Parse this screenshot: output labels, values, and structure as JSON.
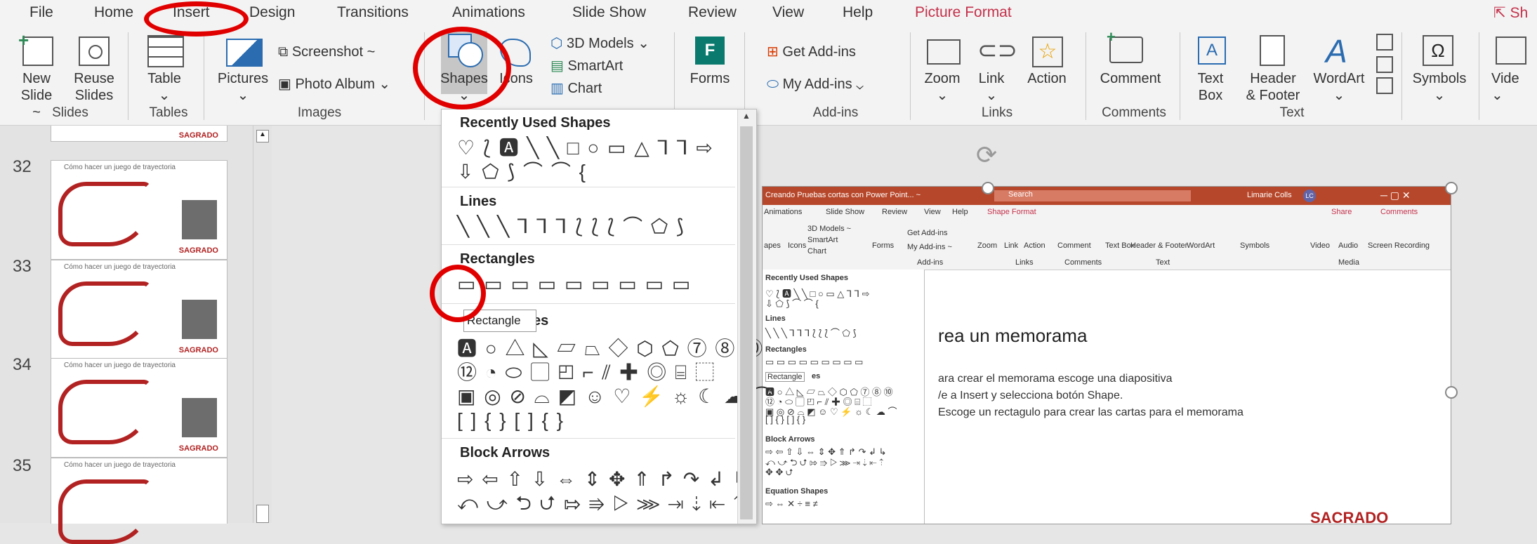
{
  "tabs": [
    "File",
    "Home",
    "Insert",
    "Design",
    "Transitions",
    "Animations",
    "Slide Show",
    "Review",
    "View",
    "Help",
    "Picture Format"
  ],
  "share_label": "Sh",
  "ribbon": {
    "new_slide": [
      "New",
      "Slide ~"
    ],
    "reuse_slides": [
      "Reuse",
      "Slides"
    ],
    "table": "Table",
    "pictures": "Pictures",
    "screenshot": "Screenshot ~",
    "photo_album": "Photo Album",
    "shapes": "Shapes",
    "icons": "Icons",
    "models_3d": "3D Models",
    "smartart": "SmartArt",
    "chart": "Chart",
    "forms": "Forms",
    "get_addins": "Get Add-ins",
    "my_addins": "My Add-ins",
    "zoom": "Zoom",
    "link": "Link",
    "action": "Action",
    "comment": "Comment",
    "text_box": [
      "Text",
      "Box"
    ],
    "header_footer": [
      "Header",
      "& Footer"
    ],
    "wordart": "WordArt",
    "symbols": "Symbols",
    "video": "Vide"
  },
  "groups": [
    "Slides",
    "Tables",
    "Images",
    "Add-ins",
    "Links",
    "Comments",
    "Text"
  ],
  "slides": [
    {
      "num": "32",
      "title": "Cómo hacer un juego de trayectoria"
    },
    {
      "num": "33",
      "title": "Cómo hacer un juego de trayectoria"
    },
    {
      "num": "34",
      "title": "Cómo hacer un juego de trayectoria"
    },
    {
      "num": "35",
      "title": "Cómo hacer un juego de trayectoria"
    }
  ],
  "thumb_brand": "SAGRADO",
  "dropdown": {
    "recent": "Recently Used Shapes",
    "lines": "Lines",
    "rectangles": "Rectangles",
    "basic": "es",
    "block_arrows": "Block Arrows",
    "row_recent_1": "♡ ⟅ 🅰 ╲ ╲ □ ○ ▭ △ ⅂ ⅂ ⇨",
    "row_recent_2": "⇩ ⬠ ⟆ ⌒ ⌒ {",
    "row_lines": "╲ ╲ ╲ ⅂ ⅂ ⅂ ⟅ ⟅ ⟅ ⌒ ⬠ ⟆",
    "row_rect": "▭ ▭ ▭ ▭ ▭ ▭ ▭ ▭ ▭",
    "row_basic_1": "🅰 ○ △ ◺ ▱ ⏢ ◇ ⬡ ⬠ ⑦ ⑧ ⑩",
    "row_basic_2": "⑫ ◔ ⬭ ▢ ◰ ⌐ ⫽ ✚ ◎ ⌸ ⬚",
    "row_basic_3": "▣ ◎ ⊘ ⌓ ◩ ☺ ♡ ⚡ ☼ ☾ ☁ ⌒",
    "row_basic_4": "[ ] { } [ ] { }",
    "row_arrows_1": "⇨ ⇦ ⇧ ⇩ ⇔ ⇕ ✥ ⇑ ↱ ↷ ↲ ↳",
    "row_arrows_2": "⤺ ⤻ ⮌ ⮍ ⇰ ⇛ ▷ ⋙ ⇥ ⇣ ⇤ ⇡",
    "row_arrows_3": "✥ ✥ ⮍",
    "tooltip": "Rectangle"
  },
  "inner": {
    "title": "Creando Pruebas cortas con Power Point... ~",
    "search": "Search",
    "user": "Limarie Colls",
    "user_initials": "LC",
    "tabs": [
      "Animations",
      "Slide Show",
      "Review",
      "View",
      "Help",
      "Shape Format"
    ],
    "share": "Share",
    "comments": "Comments",
    "ribbon": [
      "apes",
      "Icons",
      "3D Models ~",
      "SmartArt",
      "Chart",
      "Forms",
      "Get Add-ins",
      "My Add-ins ~",
      "Zoom",
      "Link",
      "Action",
      "Comment",
      "Text Box",
      "Header & Footer",
      "WordArt",
      "Symbols",
      "Video",
      "Audio",
      "Screen Recording"
    ],
    "groups": [
      "Add-ins",
      "Links",
      "Comments",
      "Text",
      "Media"
    ],
    "dd": [
      "Recently Used Shapes",
      "Lines",
      "Rectangles",
      "Rectangle",
      "es",
      "Block Arrows",
      "Equation Shapes"
    ],
    "slide_title": "rea un memorama",
    "lines": [
      "ara crear el memorama escoge una diapositiva",
      "/e a Insert y selecciona botón Shape.",
      "Escoge un rectagulo para crear las cartas para el memorama"
    ],
    "brand": "SACRADO"
  },
  "colors": {
    "annotation": "#e10000",
    "accent": "#b7472a",
    "picture_format": "#c4314b"
  }
}
